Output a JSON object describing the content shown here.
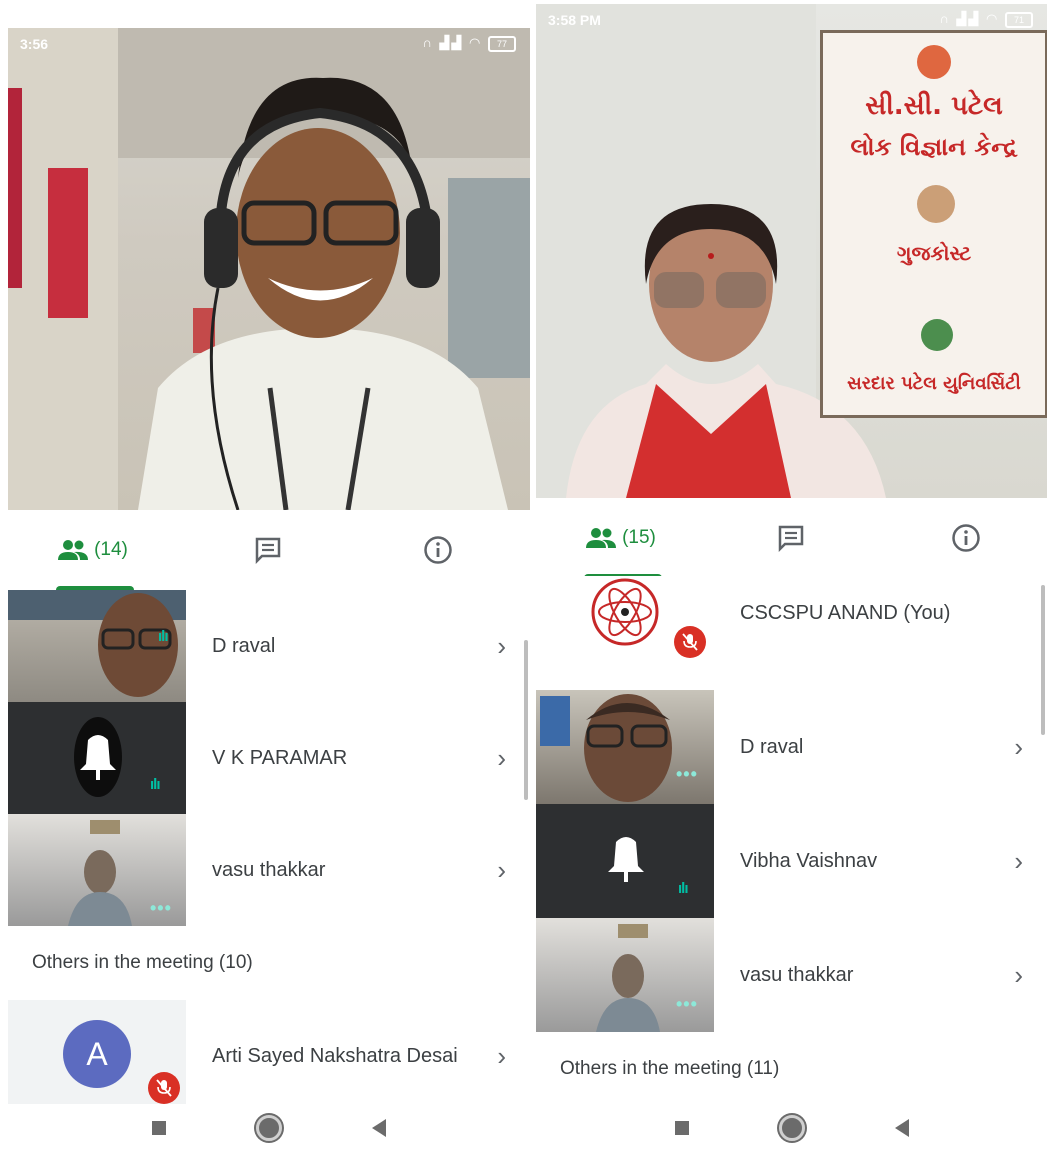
{
  "left": {
    "status": {
      "time": "3:56",
      "battery": "77"
    },
    "tabs": {
      "people_count": "(14)"
    },
    "participants": [
      {
        "name": "D raval"
      },
      {
        "name": "V K PARAMAR"
      },
      {
        "name": "vasu thakkar"
      }
    ],
    "others_heading": "Others in the meeting (10)",
    "others": [
      {
        "name": "Arti Sayed Nakshatra Desai",
        "initial": "A"
      }
    ]
  },
  "right": {
    "status": {
      "time": "3:58 PM",
      "battery": "71"
    },
    "banner": {
      "line1": "સી.સી. પટેલ",
      "line2": "લોક વિજ્ઞાન કેન્દ્ર",
      "line3": "ગુજકોસ્ટ",
      "line4": "સરદાર પટેલ યુનિવર્સિટી"
    },
    "tabs": {
      "people_count": "(15)"
    },
    "participants": [
      {
        "name": "CSCSPU ANAND (You)"
      },
      {
        "name": "D raval"
      },
      {
        "name": "Vibha Vaishnav"
      },
      {
        "name": "vasu thakkar"
      }
    ],
    "others_heading": "Others in the meeting (11)"
  },
  "icons": {
    "people": "people-icon",
    "chat": "chat-icon",
    "info": "info-icon",
    "chevron": "chevron-right-icon",
    "mic_off": "mic-off-icon"
  },
  "colors": {
    "accent_green": "#1e8e3e",
    "mic_off_red": "#d93025",
    "avatar_blue": "#5c6bc0"
  }
}
